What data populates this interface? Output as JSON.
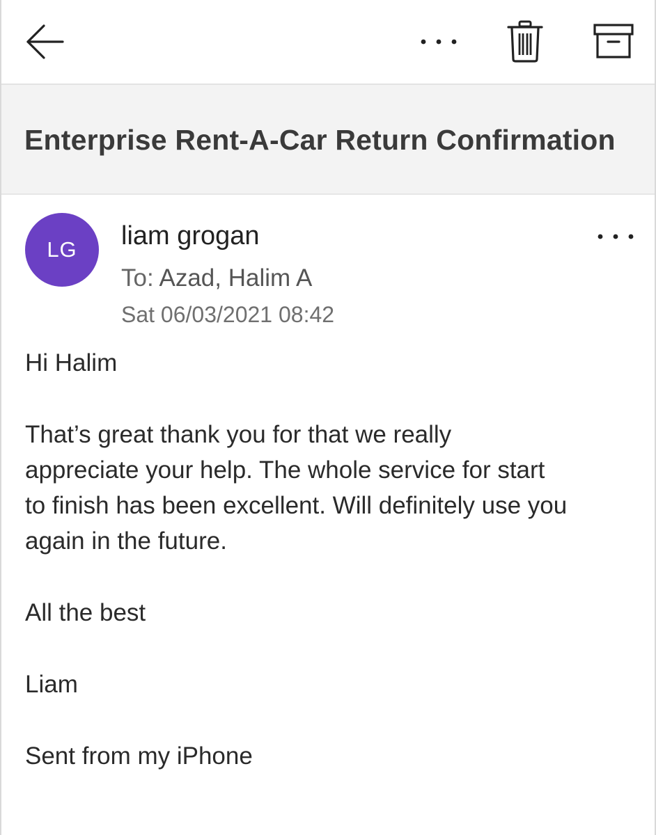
{
  "toolbar": {
    "back_icon": "arrow-left-icon",
    "more_icon": "ellipsis-icon",
    "delete_icon": "trash-icon",
    "archive_icon": "archive-icon"
  },
  "email": {
    "subject": "Enterprise Rent-A-Car Return Confirmation",
    "avatar_initials": "LG",
    "avatar_color": "#6b40c4",
    "sender": "liam grogan",
    "to_label": "To:",
    "to_name": "Azad, Halim A",
    "date": "Sat 06/03/2021 08:42",
    "body": {
      "greeting": "Hi Halim",
      "paragraph": "That’s great thank you for that we really\nappreciate your help. The whole service for start\nto finish has been excellent. Will definitely use you\nagain in the future.",
      "closing": "All the best",
      "signature": "Liam",
      "footer": "Sent from my iPhone"
    }
  }
}
